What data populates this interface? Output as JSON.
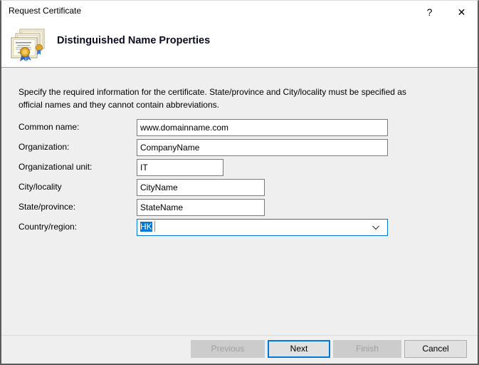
{
  "window": {
    "title": "Request Certificate",
    "help_label": "?",
    "close_label": "✕"
  },
  "header": {
    "title": "Distinguished Name Properties",
    "icon": "certificate-stack-icon"
  },
  "body": {
    "description": "Specify the required information for the certificate. State/province and City/locality must be specified as official names and they cannot contain abbreviations.",
    "fields": [
      {
        "label": "Common name:",
        "value": "www.domainname.com",
        "placeholder": "",
        "type": "text"
      },
      {
        "label": "Organization:",
        "value": "CompanyName",
        "placeholder": "",
        "type": "text"
      },
      {
        "label": "Organizational unit:",
        "value": "IT",
        "placeholder": "",
        "type": "text"
      },
      {
        "label": "City/locality",
        "value": "CityName",
        "placeholder": "",
        "type": "text"
      },
      {
        "label": "State/province:",
        "value": "StateName",
        "placeholder": "",
        "type": "text"
      },
      {
        "label": "Country/region:",
        "value": "HK",
        "placeholder": "",
        "type": "combobox"
      }
    ]
  },
  "footer": {
    "buttons": [
      {
        "label": "Previous",
        "state": "disabled"
      },
      {
        "label": "Next",
        "state": "default"
      },
      {
        "label": "Finish",
        "state": "disabled"
      },
      {
        "label": "Cancel",
        "state": "normal"
      }
    ]
  },
  "colors": {
    "accent": "#0078d7",
    "body_background": "#efefef",
    "header_background": "#ffffff",
    "button_face": "#e1e1e1",
    "disabled_text": "#a0a0a0"
  }
}
